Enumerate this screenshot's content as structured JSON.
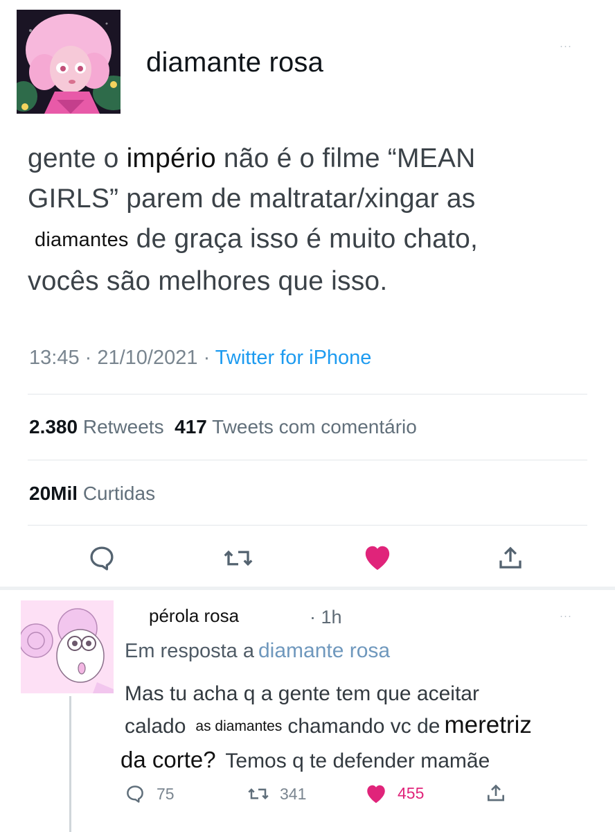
{
  "tweet": {
    "author": {
      "display_name": "diamante rosa"
    },
    "more_label": "···",
    "text_lines": [
      {
        "before": "gente o ",
        "overlay": "império",
        "after": " não é o filme “MEAN"
      },
      {
        "text": "GIRLS” parem de maltratar/xingar as"
      },
      {
        "overlay": "diamantes",
        "after": " de graça isso é muito chato,"
      },
      {
        "text": "vocês são melhores que isso."
      }
    ],
    "meta": {
      "time": "13:45",
      "separator": " · ",
      "date": "21/10/2021",
      "source": "Twitter for iPhone"
    },
    "stats": {
      "retweets_count": "2.380",
      "retweets_label": "Retweets",
      "quotes_count": "417",
      "quotes_label": "Tweets com comentário",
      "likes_count": "20Mil",
      "likes_label": "Curtidas"
    },
    "actions": [
      "reply-icon",
      "retweet-icon",
      "heart-icon-liked",
      "share-icon"
    ]
  },
  "reply": {
    "author": {
      "display_name": "pérola rosa"
    },
    "time": "· 1h",
    "more_label": "···",
    "in_reply_to_label": "Em resposta a",
    "in_reply_to_name": "diamante rosa",
    "text_lines": [
      {
        "text": "Mas tu acha q a gente tem que aceitar"
      },
      {
        "before": "calado",
        "overlay_small": "as diamantes",
        "middle": "chamando vc de",
        "overlay_big": "meretriz"
      },
      {
        "overlay_big": "da corte?",
        "after": " Temos q te defender mamãe"
      }
    ],
    "counts": {
      "replies": "75",
      "retweets": "341",
      "likes": "455"
    }
  },
  "colors": {
    "accent": "#1d9bf0",
    "like": "#e0247a",
    "mention": "#6f98bd",
    "muted": "#79858f"
  }
}
